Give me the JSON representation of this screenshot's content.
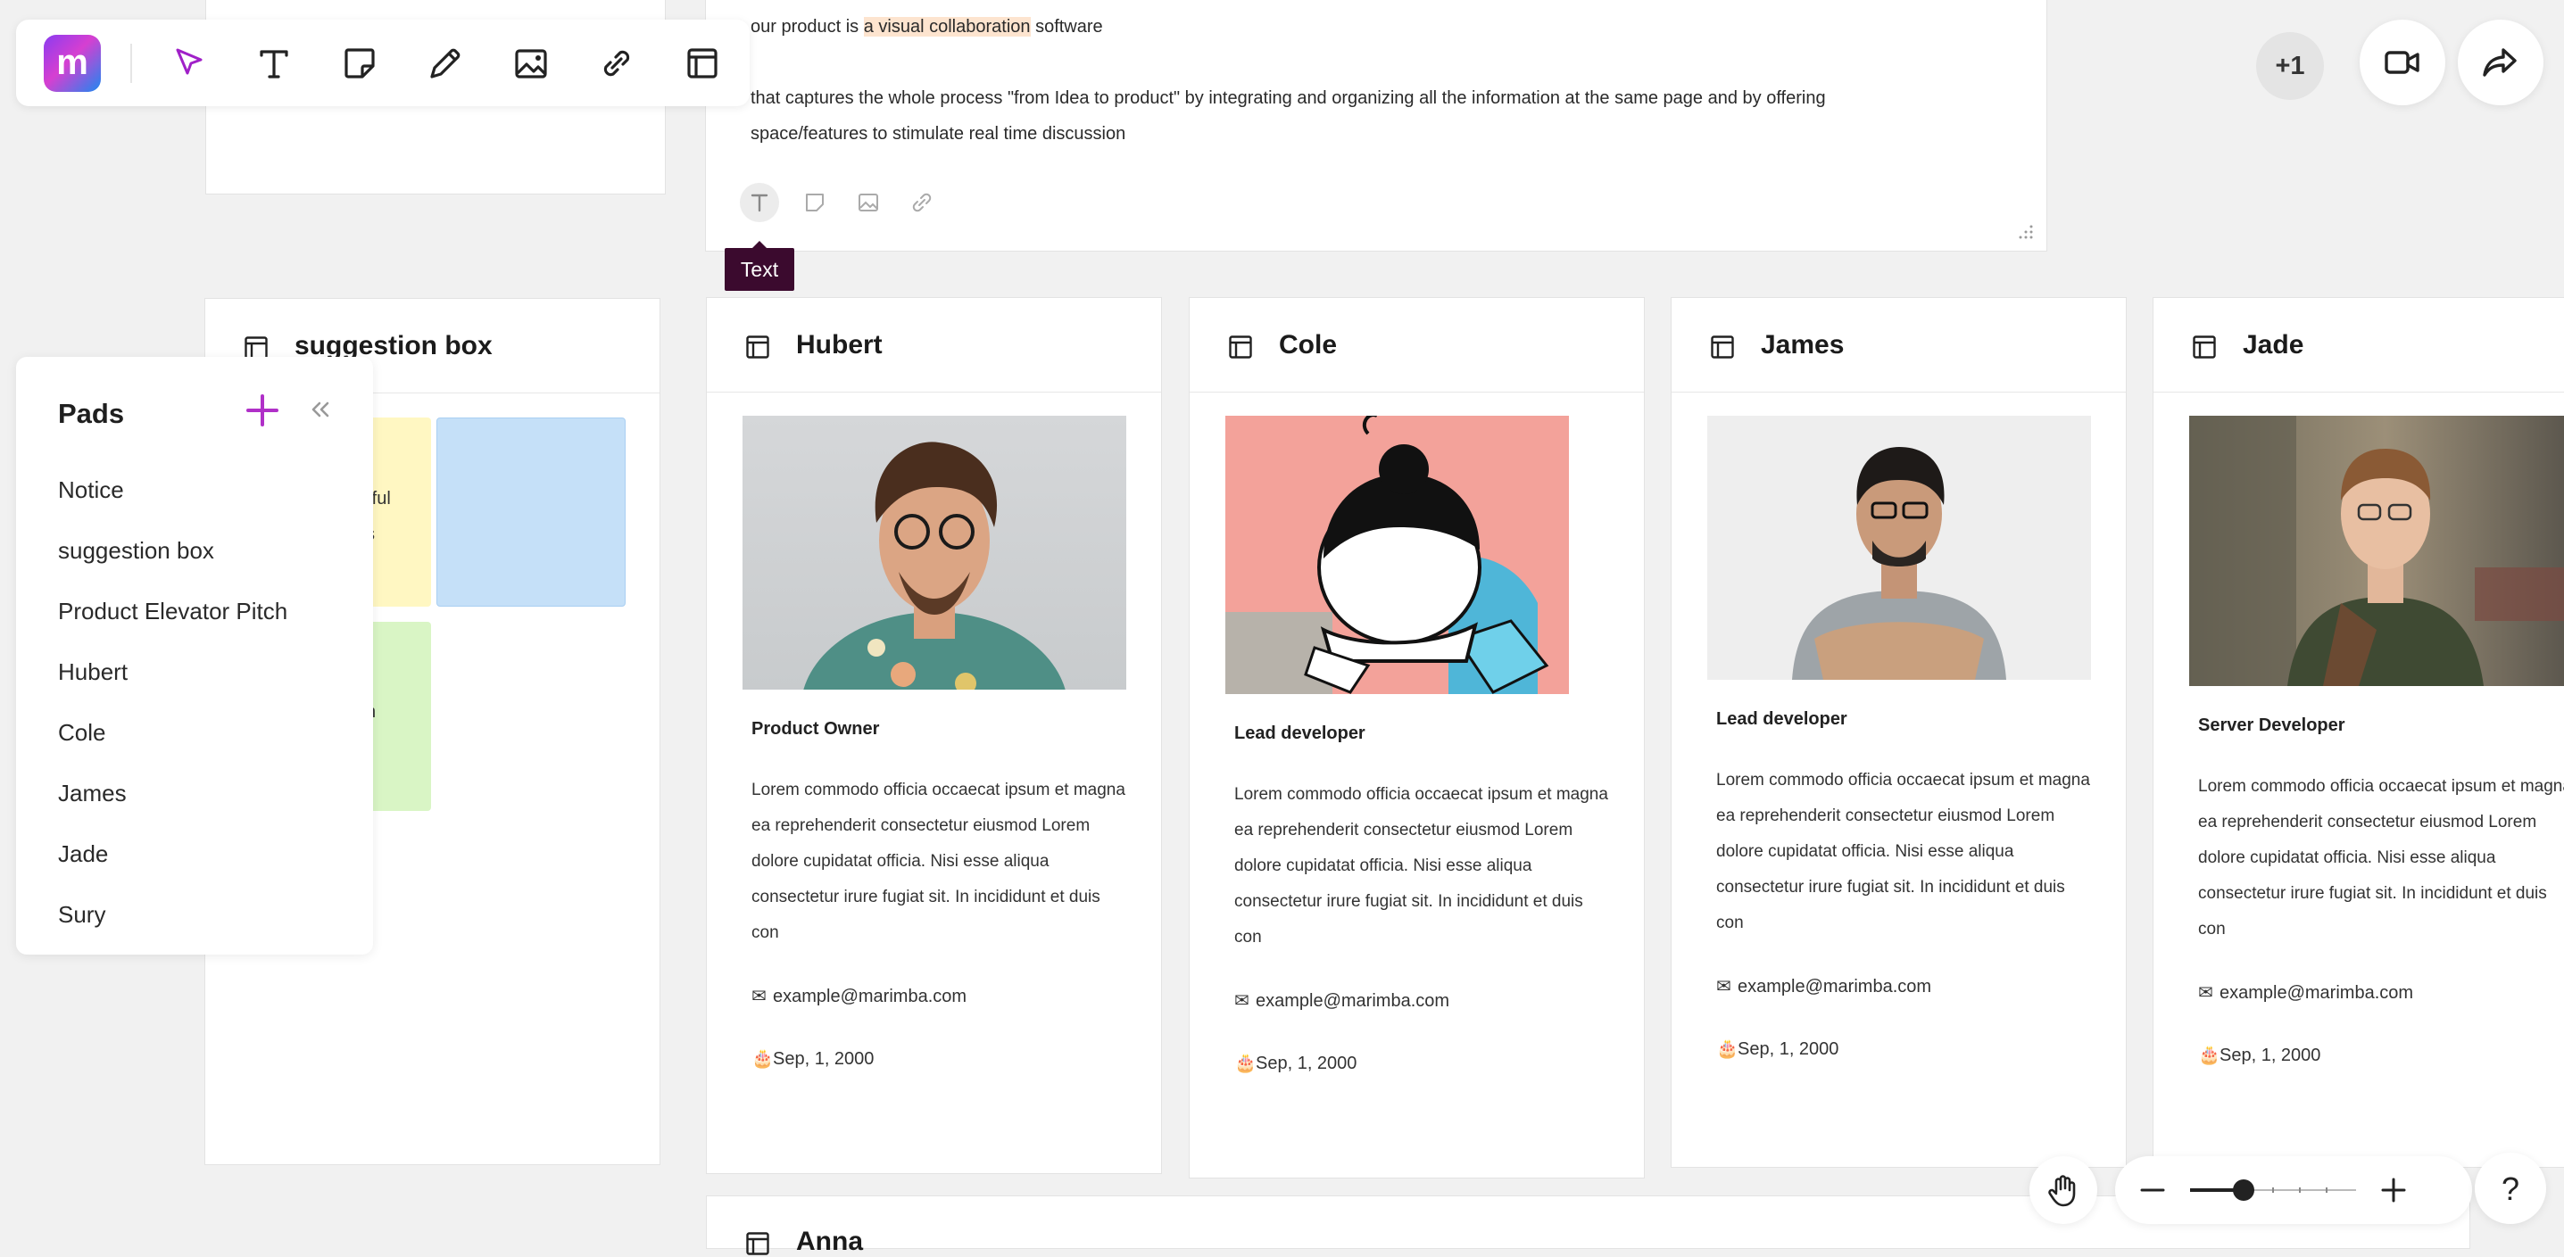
{
  "toolbar": {
    "logo_text": "m",
    "tools": [
      {
        "name": "select",
        "icon": "cursor-icon"
      },
      {
        "name": "text",
        "icon": "text-icon"
      },
      {
        "name": "sticky-note",
        "icon": "sticky-note-icon"
      },
      {
        "name": "pencil",
        "icon": "pencil-icon"
      },
      {
        "name": "image",
        "icon": "image-icon"
      },
      {
        "name": "link",
        "icon": "link-icon"
      },
      {
        "name": "pad",
        "icon": "pad-icon"
      }
    ],
    "accent_color": "#a020c8"
  },
  "top_right": {
    "participants_badge": "+1",
    "video_icon": "video-camera-icon",
    "share_icon": "share-arrow-icon"
  },
  "text_card": {
    "line1_prefix": "our product is ",
    "line1_highlight": "a visual collaboration",
    "line1_suffix": " software",
    "line2": "that captures the whole process \"from Idea to product\" by integrating and organizing all the information at the same page and by offering",
    "line3": "space/features to stimulate real time discussion",
    "tooltip": "Text"
  },
  "notice_card": {},
  "pads_panel": {
    "title": "Pads",
    "items": [
      "Notice",
      "suggestion box",
      "Product Elevator Pitch",
      "Hubert",
      "Cole",
      "James",
      "Jade",
      "Sury"
    ]
  },
  "suggestion_box": {
    "title": "suggestion box",
    "notes": [
      {
        "text_a": "rful",
        "text_b": "s",
        "color": "#fff7c2"
      },
      {
        "text_a": "",
        "text_b": "",
        "color": "#c5e0f8"
      },
      {
        "text_a": "h",
        "text_b": "",
        "color": "#d9f5c5"
      }
    ]
  },
  "pads": [
    {
      "title": "Hubert",
      "role": "Product Owner",
      "description": "Lorem commodo officia occaecat ipsum et magna ea reprehenderit consectetur eiusmod Lorem dolore cupidatat officia. Nisi esse aliqua consectetur irure fugiat sit. In incididunt et duis con",
      "email": "example@marimba.com",
      "birthday": "Sep, 1,  2000"
    },
    {
      "title": "Cole",
      "role": "Lead developer",
      "description": "Lorem commodo officia occaecat ipsum et magna ea reprehenderit consectetur eiusmod Lorem dolore cupidatat officia. Nisi esse aliqua consectetur irure fugiat sit. In incididunt et duis con",
      "email": "example@marimba.com",
      "birthday": "Sep, 1,  2000"
    },
    {
      "title": "James",
      "role": "Lead developer",
      "description": "Lorem commodo officia occaecat ipsum et magna ea reprehenderit consectetur eiusmod Lorem dolore cupidatat officia. Nisi esse aliqua consectetur irure fugiat sit. In incididunt et duis con",
      "email": "example@marimba.com",
      "birthday": "Sep, 1,  2000"
    },
    {
      "title": "Jade",
      "role": "Server Developer",
      "description": "Lorem commodo officia occaecat ipsum et magna ea reprehenderit consectetur eiusmod Lorem dolore cupidatat officia. Nisi esse aliqua consectetur irure fugiat sit. In incididunt et duis con",
      "email": "example@marimba.com",
      "birthday": "Sep, 1,  2000"
    }
  ],
  "bottom_pad": {
    "title": "Anna"
  },
  "bottom_controls": {
    "hand_icon": "hand-icon",
    "zoom_level": 0.25,
    "help": "?"
  }
}
